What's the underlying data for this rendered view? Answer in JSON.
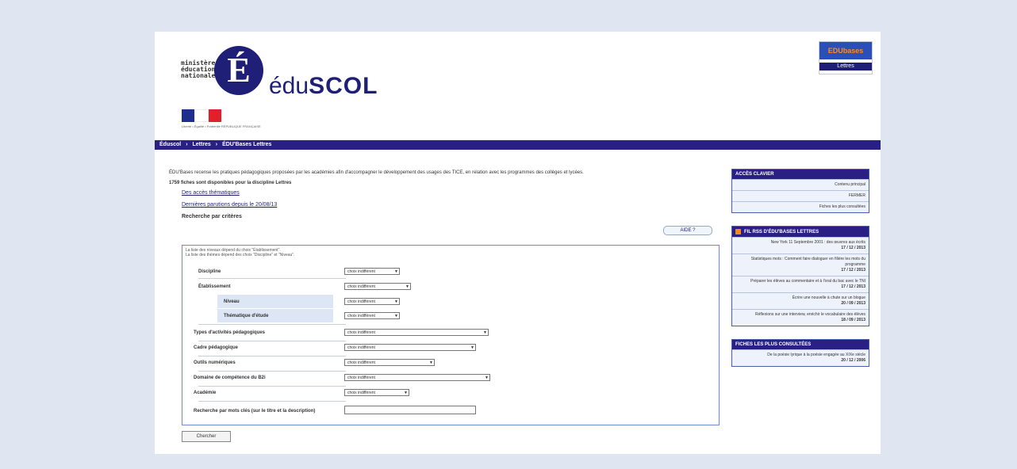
{
  "header": {
    "ministry_lines": [
      "ministère",
      "éducation",
      "nationale"
    ],
    "logo_letter": "É",
    "logo_prefix": "édu",
    "logo_suffix": "SCOL",
    "badge_top": "EDUbases",
    "badge_bottom": "Lettres",
    "flag_colors": [
      "#1f2e8c",
      "#ffffff",
      "#e0202a"
    ],
    "flag_caption": "Liberté • Égalité • Fraternité RÉPUBLIQUE FRANÇAISE"
  },
  "navbar": {
    "items": [
      "Éduscol",
      "›",
      "Lettres",
      "›",
      "ÉDU'Bases Lettres"
    ]
  },
  "main": {
    "intro": "ÉDU'Bases recense les pratiques pédagogiques proposées par les académies afin d'accompagner le développement des usages des TICE, en relation avec les programmes des collèges et lycées.",
    "count": "1759 fiches sont disponibles pour la discipline Lettres",
    "links": [
      "Des accès thématiques",
      "Dernières parutions depuis le 20/08/13"
    ],
    "criteria_heading": "Recherche par critères",
    "aide_label": "AIDE ?",
    "hint_line1": "La liste des niveaux dépend du choix \"Établissement\".",
    "hint_line2": "La liste des thèmes dépend des choix \"Discipline\" et \"Niveau\".",
    "form": {
      "discipline": {
        "label": "Discipline",
        "value": "choix indifférent"
      },
      "etablissement": {
        "label": "Établissement",
        "value": "choix indifférent"
      },
      "niveau": {
        "label": "Niveau",
        "value": "choix indifférent"
      },
      "thematique": {
        "label": "Thématique d'étude",
        "value": "choix indifférent"
      },
      "types_activite": {
        "label": "Types d'activités pédagogiques",
        "value": "choix indifférent"
      },
      "cadre": {
        "label": "Cadre pédagogique",
        "value": "choix indifférent"
      },
      "outils": {
        "label": "Outils numériques",
        "value": "choix indifférent"
      },
      "domaine_b2i": {
        "label": "Domaine de compétence du B2i",
        "value": "choix indifférent"
      },
      "academie": {
        "label": "Académie",
        "value": "choix indifférent"
      },
      "mots_cles": {
        "label": "Recherche par mots clés (sur le titre et la description)",
        "value": ""
      }
    },
    "search_button": "Chercher"
  },
  "sidebar": {
    "acces_clavier": {
      "title": "ACCÈS CLAVIER",
      "items": [
        "Contenu principal",
        "FERMER",
        "Fiches les plus consultées"
      ]
    },
    "rss": {
      "title": "FIL RSS D'ÉDU'BASES LETTRES",
      "items": [
        {
          "text": "New York 11 Septembre 2001 : des œuvres aux écrits",
          "date": "17 / 12 / 2013"
        },
        {
          "text": "Statistiques mots : Comment faire dialoguer en filière les mots du programme",
          "date": "17 / 12 / 2013"
        },
        {
          "text": "Préparer les élèves au commentaire et à l'oral du bac avec le TNI",
          "date": "17 / 12 / 2013"
        },
        {
          "text": "Écrire une nouvelle à chute sur un blogue",
          "date": "20 / 09 / 2013"
        },
        {
          "text": "Réflexions sur une interview, enrichir le vocabulaire des élèves",
          "date": "18 / 09 / 2013"
        }
      ]
    },
    "plus_consultees": {
      "title": "FICHES LES PLUS CONSULTÉES",
      "items": [
        {
          "text": "De la poésie lyrique à la poésie engagée au XIXe siècle",
          "date": "20 / 12 / 2006"
        }
      ]
    }
  }
}
